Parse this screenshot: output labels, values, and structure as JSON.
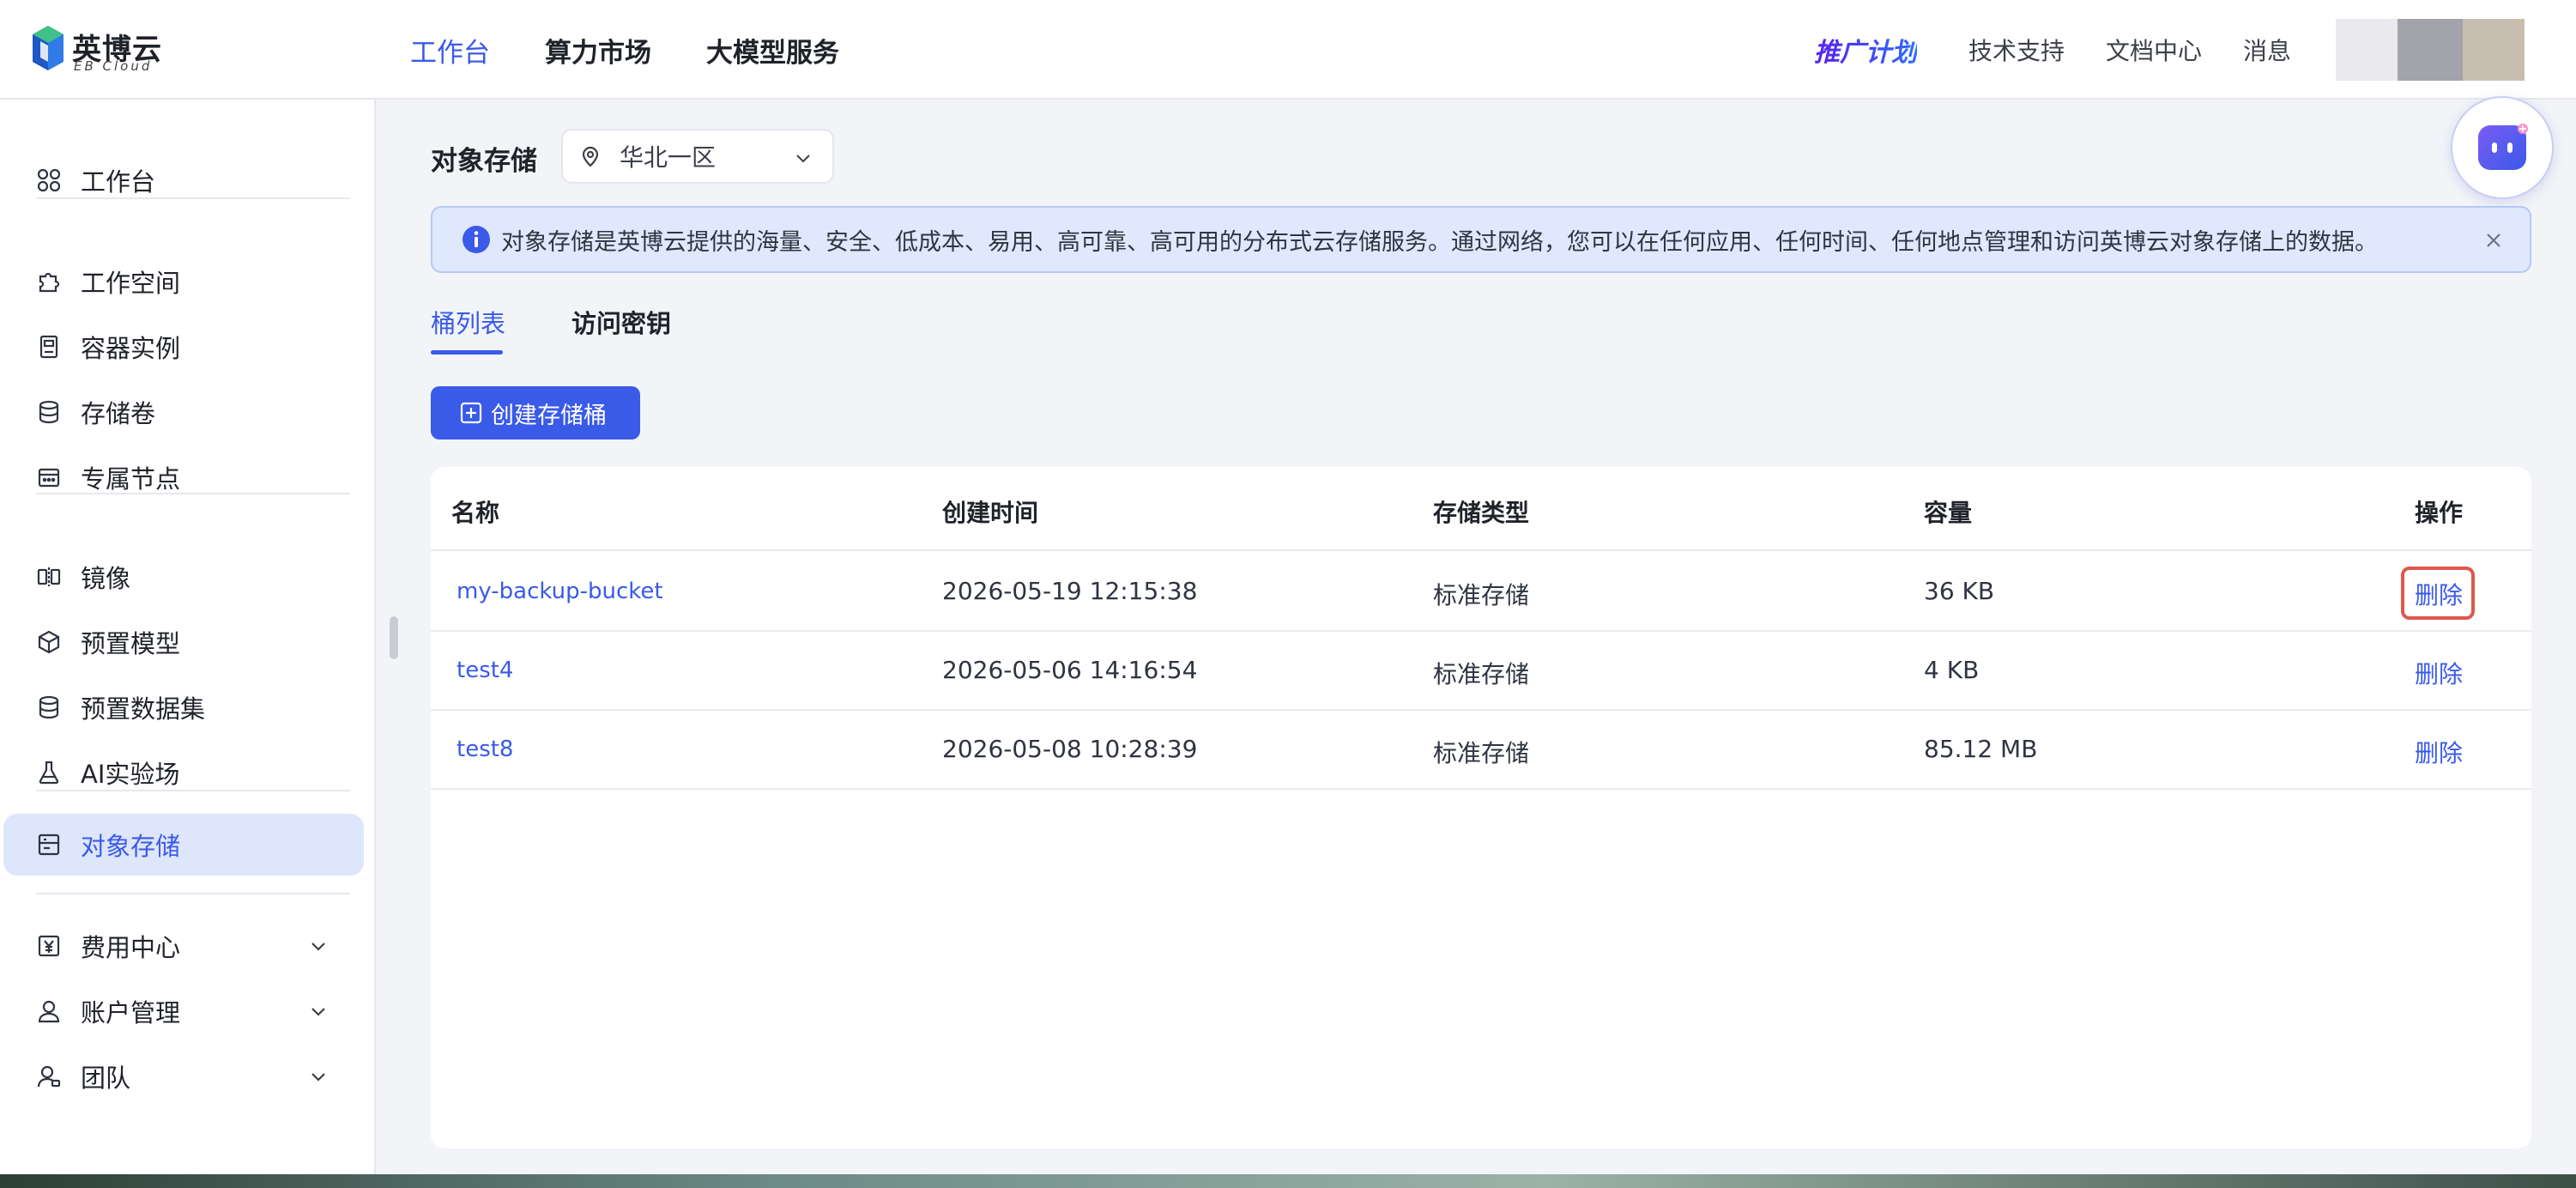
{
  "brand": {
    "name": "英博云",
    "sub": "EB Cloud"
  },
  "top_nav": [
    "工作台",
    "算力市场",
    "大模型服务"
  ],
  "top_right": {
    "promo": "推广计划",
    "links": [
      "技术支持",
      "文档中心",
      "消息"
    ]
  },
  "sidebar": {
    "items": [
      {
        "label": "工作台",
        "icon": "grid-icon"
      },
      {
        "label": "工作空间",
        "icon": "puzzle-icon"
      },
      {
        "label": "容器实例",
        "icon": "container-icon"
      },
      {
        "label": "存储卷",
        "icon": "database-icon"
      },
      {
        "label": "专属节点",
        "icon": "calendar-icon"
      },
      {
        "label": "镜像",
        "icon": "mirror-icon"
      },
      {
        "label": "预置模型",
        "icon": "cube-icon"
      },
      {
        "label": "预置数据集",
        "icon": "database-icon"
      },
      {
        "label": "AI实验场",
        "icon": "flask-icon"
      },
      {
        "label": "对象存储",
        "icon": "storage-icon",
        "active": true
      },
      {
        "label": "费用中心",
        "icon": "yen-icon"
      },
      {
        "label": "账户管理",
        "icon": "user-icon"
      },
      {
        "label": "团队",
        "icon": "team-icon"
      }
    ]
  },
  "page": {
    "title": "对象存储",
    "region": "华北一区",
    "notice": "对象存储是英博云提供的海量、安全、低成本、易用、高可靠、高可用的分布式云存储服务。通过网络，您可以在任何应用、任何时间、任何地点管理和访问英博云对象存储上的数据。",
    "tabs": [
      "桶列表",
      "访问密钥"
    ],
    "create_button": "创建存储桶"
  },
  "table": {
    "headers": [
      "名称",
      "创建时间",
      "存储类型",
      "容量",
      "操作"
    ],
    "rows": [
      {
        "name": "my-backup-bucket",
        "created": "2026-05-19 12:15:38",
        "type": "标准存储",
        "size": "36 KB",
        "action": "删除"
      },
      {
        "name": "test4",
        "created": "2026-05-06 14:16:54",
        "type": "标准存储",
        "size": "4 KB",
        "action": "删除"
      },
      {
        "name": "test8",
        "created": "2026-05-08 10:28:39",
        "type": "标准存储",
        "size": "85.12 MB",
        "action": "删除"
      }
    ]
  },
  "colors": {
    "accent": "#3a5ae8",
    "highlight": "#e0574b",
    "notice_bg": "#dfe8fd"
  }
}
